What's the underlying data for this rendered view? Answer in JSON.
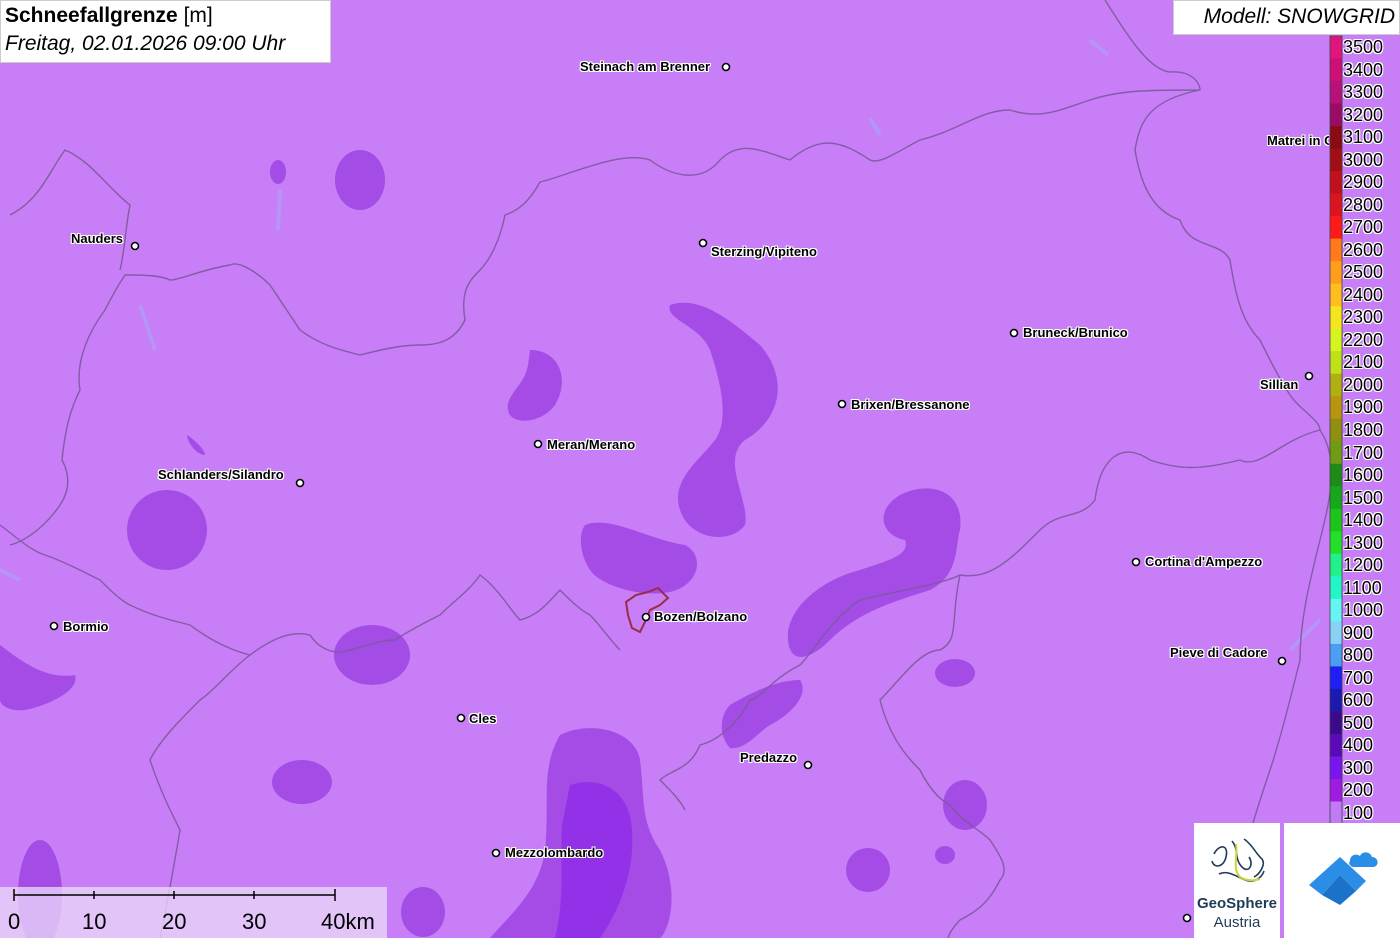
{
  "header": {
    "title": "Schneefallgrenze",
    "unit": "[m]",
    "subtitle": "Freitag, 02.01.2026 09:00 Uhr"
  },
  "model": {
    "label": "Modell: SNOWGRID"
  },
  "cities": [
    {
      "name": "Steinach am Brenner"
    },
    {
      "name": "Nauders"
    },
    {
      "name": "Sterzing/Vipiteno"
    },
    {
      "name": "Matrei in Osttirol"
    },
    {
      "name": "Bruneck/Brunico"
    },
    {
      "name": "Sillian"
    },
    {
      "name": "Brixen/Bressanone"
    },
    {
      "name": "Meran/Merano"
    },
    {
      "name": "Schlanders/Silandro"
    },
    {
      "name": "Cortina d'Ampezzo"
    },
    {
      "name": "Bormio"
    },
    {
      "name": "Bozen/Bolzano"
    },
    {
      "name": "Pieve di Cadore"
    },
    {
      "name": "Cles"
    },
    {
      "name": "Predazzo"
    },
    {
      "name": "Mezzolombardo"
    }
  ],
  "legend": {
    "ticks": [
      "3500",
      "3400",
      "3300",
      "3200",
      "3100",
      "3000",
      "2900",
      "2800",
      "2700",
      "2600",
      "2500",
      "2400",
      "2300",
      "2200",
      "2100",
      "2000",
      "1900",
      "1800",
      "1700",
      "1600",
      "1500",
      "1400",
      "1300",
      "1200",
      "1100",
      "1000",
      "900",
      "800",
      "700",
      "600",
      "500",
      "400",
      "300",
      "200",
      "100"
    ],
    "colors": [
      "#e0157e",
      "#cf0e77",
      "#b8117a",
      "#9a0a66",
      "#8a0b14",
      "#a10e16",
      "#c1111c",
      "#dc141f",
      "#ff1a1a",
      "#ff7a1a",
      "#ff9d1c",
      "#ffbd1f",
      "#f5e51f",
      "#d6f51f",
      "#c0e01a",
      "#b0b014",
      "#b89410",
      "#8f8f12",
      "#6f9c14",
      "#1f8a1a",
      "#16a81a",
      "#1cc41c",
      "#22e02a",
      "#22f08a",
      "#22f5c8",
      "#66f5f5",
      "#8ad2f5",
      "#4b9ef5",
      "#1f1ff5",
      "#1a1ab0",
      "#3a0a8a",
      "#5a0ab8",
      "#7a14f0",
      "#a01ae0",
      "#c07af5"
    ]
  },
  "scale": {
    "labels": [
      "0",
      "10",
      "20",
      "30",
      "40km"
    ]
  },
  "logos": {
    "geosphere_line1": "GeoSphere",
    "geosphere_line2": "Austria"
  },
  "colors": {
    "background_low": "#c77ef7",
    "zone_mid": "#a34ae6",
    "zone_deep": "#9a2fe8",
    "border": "#7a5a9a",
    "bolzano_outline": "#9a2b4a"
  }
}
